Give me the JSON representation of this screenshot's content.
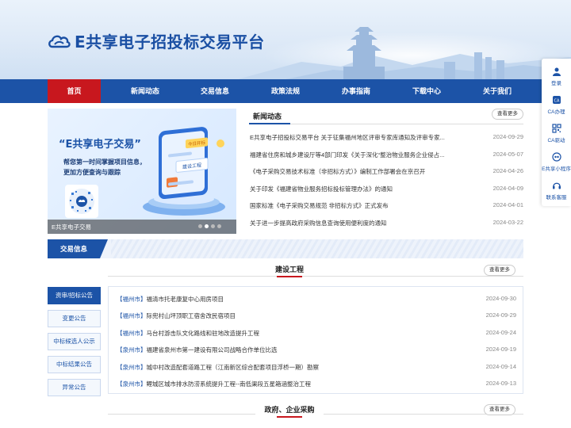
{
  "brand": {
    "title": "E共享电子招投标交易平台"
  },
  "nav": {
    "items": [
      {
        "label": "首页",
        "active": true
      },
      {
        "label": "新闻动态"
      },
      {
        "label": "交易信息"
      },
      {
        "label": "政策法规"
      },
      {
        "label": "办事指南"
      },
      {
        "label": "下载中心"
      },
      {
        "label": "关于我们"
      }
    ]
  },
  "float_bar": {
    "items": [
      {
        "label": "登录",
        "icon": "user-icon"
      },
      {
        "label": "CA办理",
        "icon": "ca-icon"
      },
      {
        "label": "CA驱动",
        "icon": "qrcode-icon"
      },
      {
        "label": "E共享小程序",
        "icon": "miniapp-icon"
      },
      {
        "label": "联系客服",
        "icon": "headset-icon"
      }
    ]
  },
  "carousel": {
    "headline": "“E共享电子交易”",
    "line1": "帮您第一时间掌握项目信息，",
    "line2": "更加方便查询与跟踪",
    "phone_label": "今日开标",
    "card_label": "建设工程",
    "caption": "E共享电子交易",
    "slides": 4,
    "active_slide": 2
  },
  "news": {
    "title": "新闻动态",
    "more": "查看更多",
    "items": [
      {
        "title": "E共享电子招投标交易平台 关于征集福州地区评审专家库通知及评审专家...",
        "date": "2024-09-29"
      },
      {
        "title": "福建省住房和城乡建设厅等4部门印发《关于深化“整治物业服务企业侵占...",
        "date": "2024-05-07"
      },
      {
        "title": "《电子采购交易技术标准（非招标方式）》编制工作部署会在京召开",
        "date": "2024-04-26"
      },
      {
        "title": "关于印发《福建省物业服务招标投标管理办法》的通知",
        "date": "2024-04-09"
      },
      {
        "title": "国家标准《电子采购交易规范 非招标方式》正式发布",
        "date": "2024-04-01"
      },
      {
        "title": "关于进一步提高政府采购信息查询使用便利度的通知",
        "date": "2024-03-22"
      }
    ]
  },
  "trade": {
    "band_label": "交易信息",
    "section1": {
      "title": "建设工程",
      "more": "查看更多"
    },
    "section2": {
      "title": "政府、企业采购",
      "more": "查看更多"
    },
    "tabs": [
      {
        "label": "资审/招标公告",
        "active": true
      },
      {
        "label": "变更公告"
      },
      {
        "label": "中标候选人公示"
      },
      {
        "label": "中标结果公告"
      },
      {
        "label": "异常公告"
      }
    ],
    "items": [
      {
        "city": "【福州市】",
        "name": "福清市托老康复中心用房项目",
        "date": "2024-09-30"
      },
      {
        "city": "【福州市】",
        "name": "际兜村山坪顶职工宿舍改民宿项目",
        "date": "2024-09-29"
      },
      {
        "city": "【福州市】",
        "name": "马台村游击队文化路线和驻地改造提升工程",
        "date": "2024-09-24"
      },
      {
        "city": "【泉州市】",
        "name": "福建省泉州市第一建设有限公司战略合作单位比选",
        "date": "2024-09-19"
      },
      {
        "city": "【泉州市】",
        "name": "城中村改造配套道路工程（江南新区综合配套项目浮桥一期）勘察",
        "date": "2024-09-14"
      },
      {
        "city": "【泉州市】",
        "name": "鲤城区城市排水防涝系统提升工程--南低渠段五星箱涵整治工程",
        "date": "2024-09-13"
      }
    ]
  },
  "colors": {
    "primary": "#1c53a7",
    "accent": "#c8171e"
  }
}
